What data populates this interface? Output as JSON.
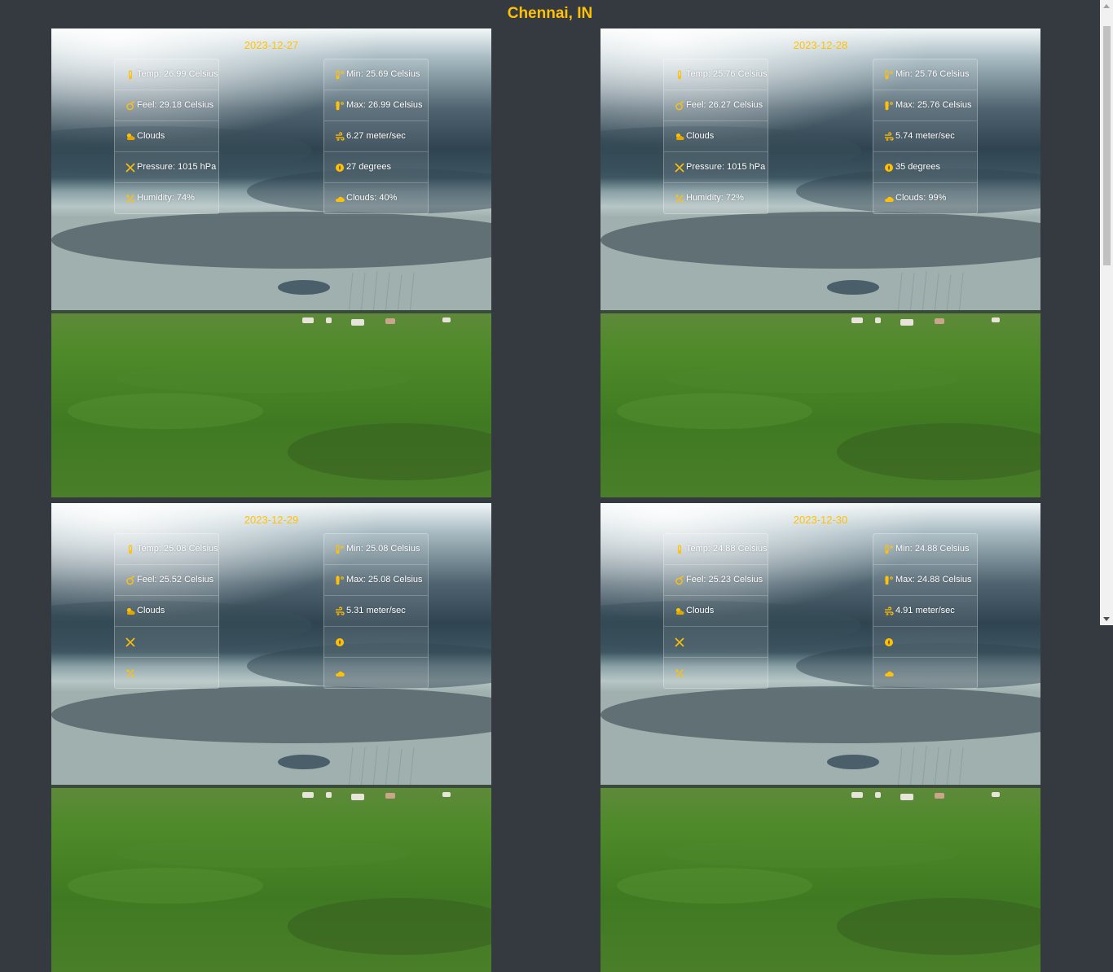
{
  "city": "Chennai, IN",
  "colors": {
    "accent": "#ffc107",
    "page_bg": "#343a40"
  },
  "cards": [
    {
      "date": "2023-12-27",
      "left": [
        {
          "icon": "thermometer-icon",
          "text": "Temp: 26.99 Celsius"
        },
        {
          "icon": "feel-icon",
          "text": "Feel: 29.18 Celsius"
        },
        {
          "icon": "cloud-sun-icon",
          "text": "Clouds"
        },
        {
          "icon": "pressure-icon",
          "text": "Pressure: 1015 hPa"
        },
        {
          "icon": "percent-icon",
          "text": "Humidity: 74%"
        }
      ],
      "right": [
        {
          "icon": "temp-min-icon",
          "text": "Min: 25.69 Celsius"
        },
        {
          "icon": "temp-max-icon",
          "text": "Max: 26.99 Celsius"
        },
        {
          "icon": "wind-icon",
          "text": "6.27 meter/sec"
        },
        {
          "icon": "compass-icon",
          "text": "27 degrees"
        },
        {
          "icon": "cloud-icon",
          "text": "Clouds: 40%"
        }
      ]
    },
    {
      "date": "2023-12-28",
      "left": [
        {
          "icon": "thermometer-icon",
          "text": "Temp: 25.76 Celsius"
        },
        {
          "icon": "feel-icon",
          "text": "Feel: 26.27 Celsius"
        },
        {
          "icon": "cloud-sun-icon",
          "text": "Clouds"
        },
        {
          "icon": "pressure-icon",
          "text": "Pressure: 1015 hPa"
        },
        {
          "icon": "percent-icon",
          "text": "Humidity: 72%"
        }
      ],
      "right": [
        {
          "icon": "temp-min-icon",
          "text": "Min: 25.76 Celsius"
        },
        {
          "icon": "temp-max-icon",
          "text": "Max: 25.76 Celsius"
        },
        {
          "icon": "wind-icon",
          "text": "5.74 meter/sec"
        },
        {
          "icon": "compass-icon",
          "text": "35 degrees"
        },
        {
          "icon": "cloud-icon",
          "text": "Clouds: 99%"
        }
      ]
    },
    {
      "date": "2023-12-29",
      "left": [
        {
          "icon": "thermometer-icon",
          "text": "Temp: 25.08 Celsius"
        },
        {
          "icon": "feel-icon",
          "text": "Feel: 25.52 Celsius"
        },
        {
          "icon": "cloud-sun-icon",
          "text": "Clouds"
        },
        {
          "icon": "pressure-icon",
          "text": ""
        },
        {
          "icon": "percent-icon",
          "text": ""
        }
      ],
      "right": [
        {
          "icon": "temp-min-icon",
          "text": "Min: 25.08 Celsius"
        },
        {
          "icon": "temp-max-icon",
          "text": "Max: 25.08 Celsius"
        },
        {
          "icon": "wind-icon",
          "text": "5.31 meter/sec"
        },
        {
          "icon": "compass-icon",
          "text": ""
        },
        {
          "icon": "cloud-icon",
          "text": ""
        }
      ]
    },
    {
      "date": "2023-12-30",
      "left": [
        {
          "icon": "thermometer-icon",
          "text": "Temp: 24.88 Celsius"
        },
        {
          "icon": "feel-icon",
          "text": "Feel: 25.23 Celsius"
        },
        {
          "icon": "cloud-sun-icon",
          "text": "Clouds"
        },
        {
          "icon": "pressure-icon",
          "text": ""
        },
        {
          "icon": "percent-icon",
          "text": ""
        }
      ],
      "right": [
        {
          "icon": "temp-min-icon",
          "text": "Min: 24.88 Celsius"
        },
        {
          "icon": "temp-max-icon",
          "text": "Max: 24.88 Celsius"
        },
        {
          "icon": "wind-icon",
          "text": "4.91 meter/sec"
        },
        {
          "icon": "compass-icon",
          "text": ""
        },
        {
          "icon": "cloud-icon",
          "text": ""
        }
      ]
    }
  ]
}
